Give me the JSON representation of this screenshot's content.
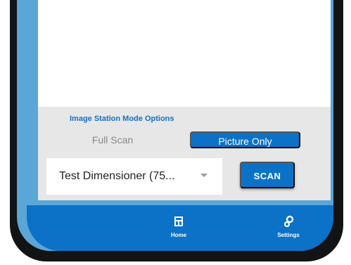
{
  "options": {
    "title": "Image Station Mode Options",
    "modes": [
      {
        "label": "Full Scan",
        "selected": false
      },
      {
        "label": "Picture Only",
        "selected": true
      }
    ]
  },
  "device_select": {
    "value": "Test Dimensioner (75...",
    "icon": "dropdown-arrow"
  },
  "scan_button": {
    "label": "SCAN"
  },
  "nav": {
    "items": [
      {
        "label": "Home",
        "icon": "home-icon"
      },
      {
        "label": "Settings",
        "icon": "settings-icon"
      }
    ]
  },
  "colors": {
    "accent": "#0b72c8",
    "frame": "#111315",
    "panel": "#e7e7e7",
    "title": "#1b6fc0"
  }
}
